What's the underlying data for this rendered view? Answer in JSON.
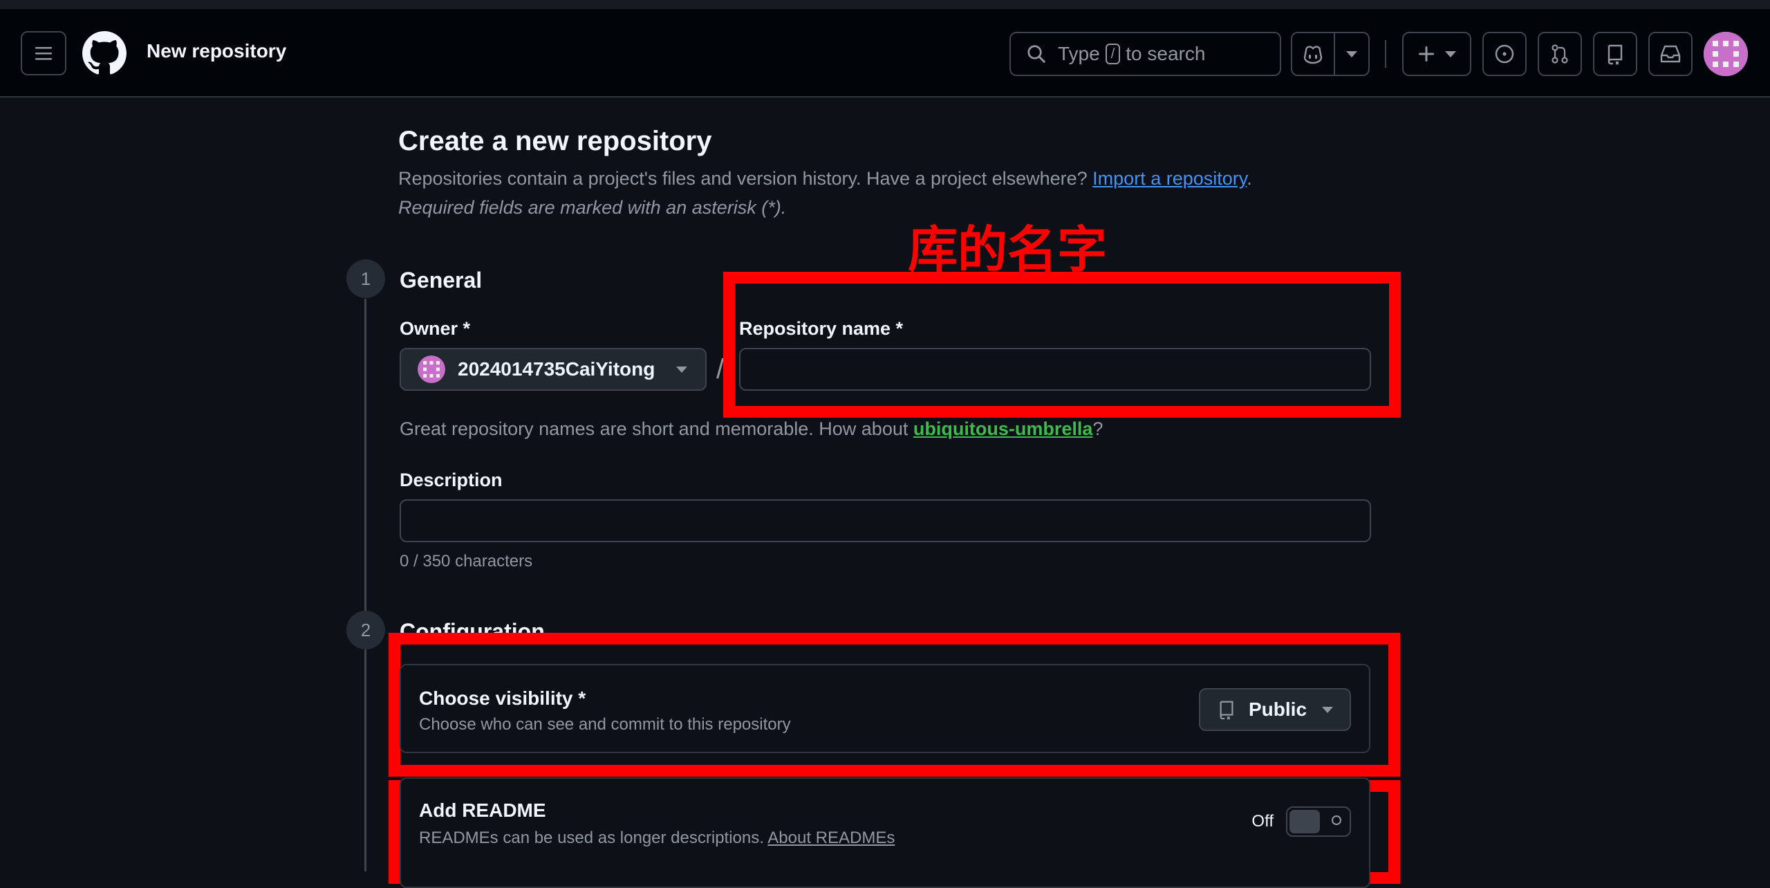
{
  "header": {
    "title": "New repository",
    "search_before": "Type",
    "search_key": "/",
    "search_after": "to search"
  },
  "page": {
    "heading": "Create a new repository",
    "subtitle": "Repositories contain a project's files and version history. Have a project elsewhere?",
    "import_link": "Import a repository",
    "subtitle_end": ".",
    "required_note": "Required fields are marked with an asterisk (*)."
  },
  "annotation": {
    "label": "库的名字",
    "box_color": "#ff0000"
  },
  "general": {
    "step": "1",
    "heading": "General",
    "owner_label": "Owner *",
    "owner_value": "2024014735CaiYitong",
    "separator": "/",
    "repo_name_label": "Repository name *",
    "repo_name_value": "",
    "hint_before": "Great repository names are short and memorable. How about",
    "hint_suggestion": "ubiquitous-umbrella",
    "hint_after": "?",
    "description_label": "Description",
    "description_value": "",
    "counter": "0 / 350 characters"
  },
  "configuration": {
    "step": "2",
    "heading": "Configuration",
    "visibility_title": "Choose visibility *",
    "visibility_desc": "Choose who can see and commit to this repository",
    "visibility_value": "Public",
    "readme_title": "Add README",
    "readme_desc": "READMEs can be used as longer descriptions.",
    "readme_link": "About READMEs",
    "readme_toggle_label": "Off",
    "readme_enabled": false
  },
  "colors": {
    "background": "#0d1117",
    "header": "#010409",
    "link": "#4493f8",
    "suggestion": "#3fb950",
    "avatar": "#c86fc9"
  }
}
